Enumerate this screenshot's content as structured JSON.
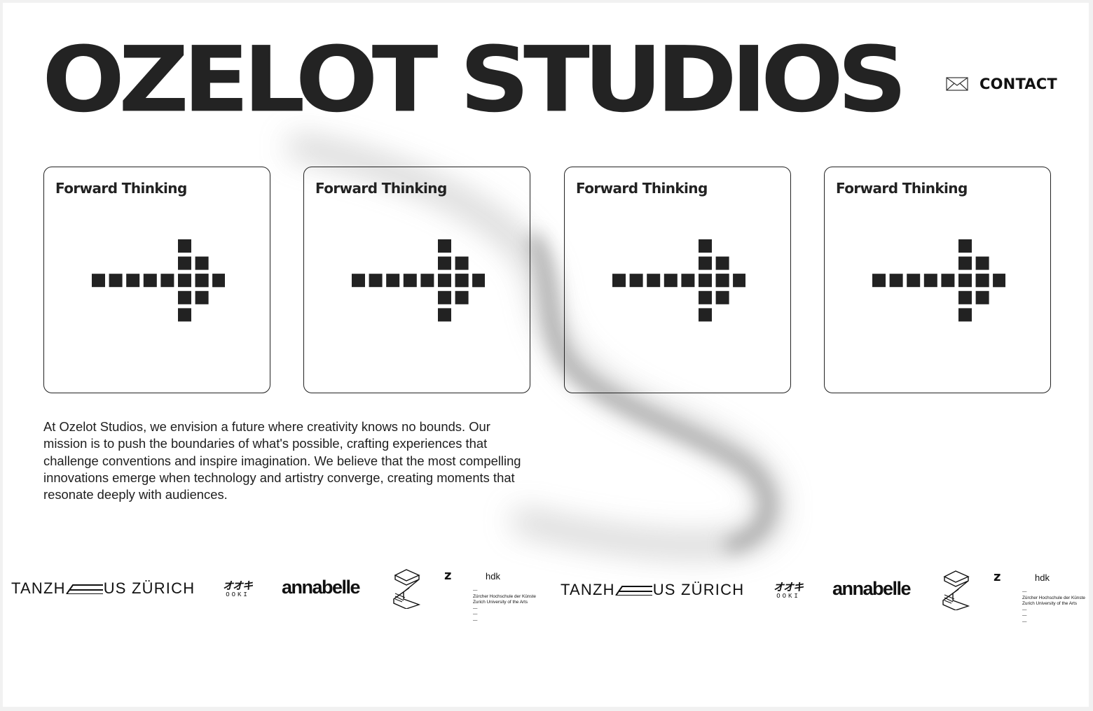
{
  "header": {
    "brand": "OZELOT STUDIOS",
    "contact_label": "CONTACT",
    "contact_icon": "envelope-icon"
  },
  "cards": [
    {
      "title": "Forward Thinking",
      "icon": "pixel-arrow-right-icon"
    },
    {
      "title": "Forward Thinking",
      "icon": "pixel-arrow-right-icon"
    },
    {
      "title": "Forward Thinking",
      "icon": "pixel-arrow-right-icon"
    },
    {
      "title": "Forward Thinking",
      "icon": "pixel-arrow-right-icon"
    }
  ],
  "mission": "At Ozelot Studios, we envision a future where creativity knows no bounds. Our mission is to push the boundaries of what's possible, crafting experiences that challenge conventions and inspire imagination. We believe that the most compelling innovations emerge when technology and artistry converge, creating moments that resonate deeply with audiences.",
  "partners": {
    "tanzhaus": {
      "before": "TANZH",
      "after": "US ZÜRICH"
    },
    "ooki": {
      "jp": "オオキ",
      "en": "OOKI"
    },
    "annabelle": "annabelle",
    "zhdk": {
      "z": "z",
      "hdk": "hdk",
      "line1": "Zürcher Hochschule der Künste",
      "line2": "Zurich University of the Arts"
    }
  },
  "colors": {
    "ink": "#222222",
    "background": "#ffffff",
    "frame": "#f1f1f1",
    "swoosh": "#8a8a8a"
  }
}
